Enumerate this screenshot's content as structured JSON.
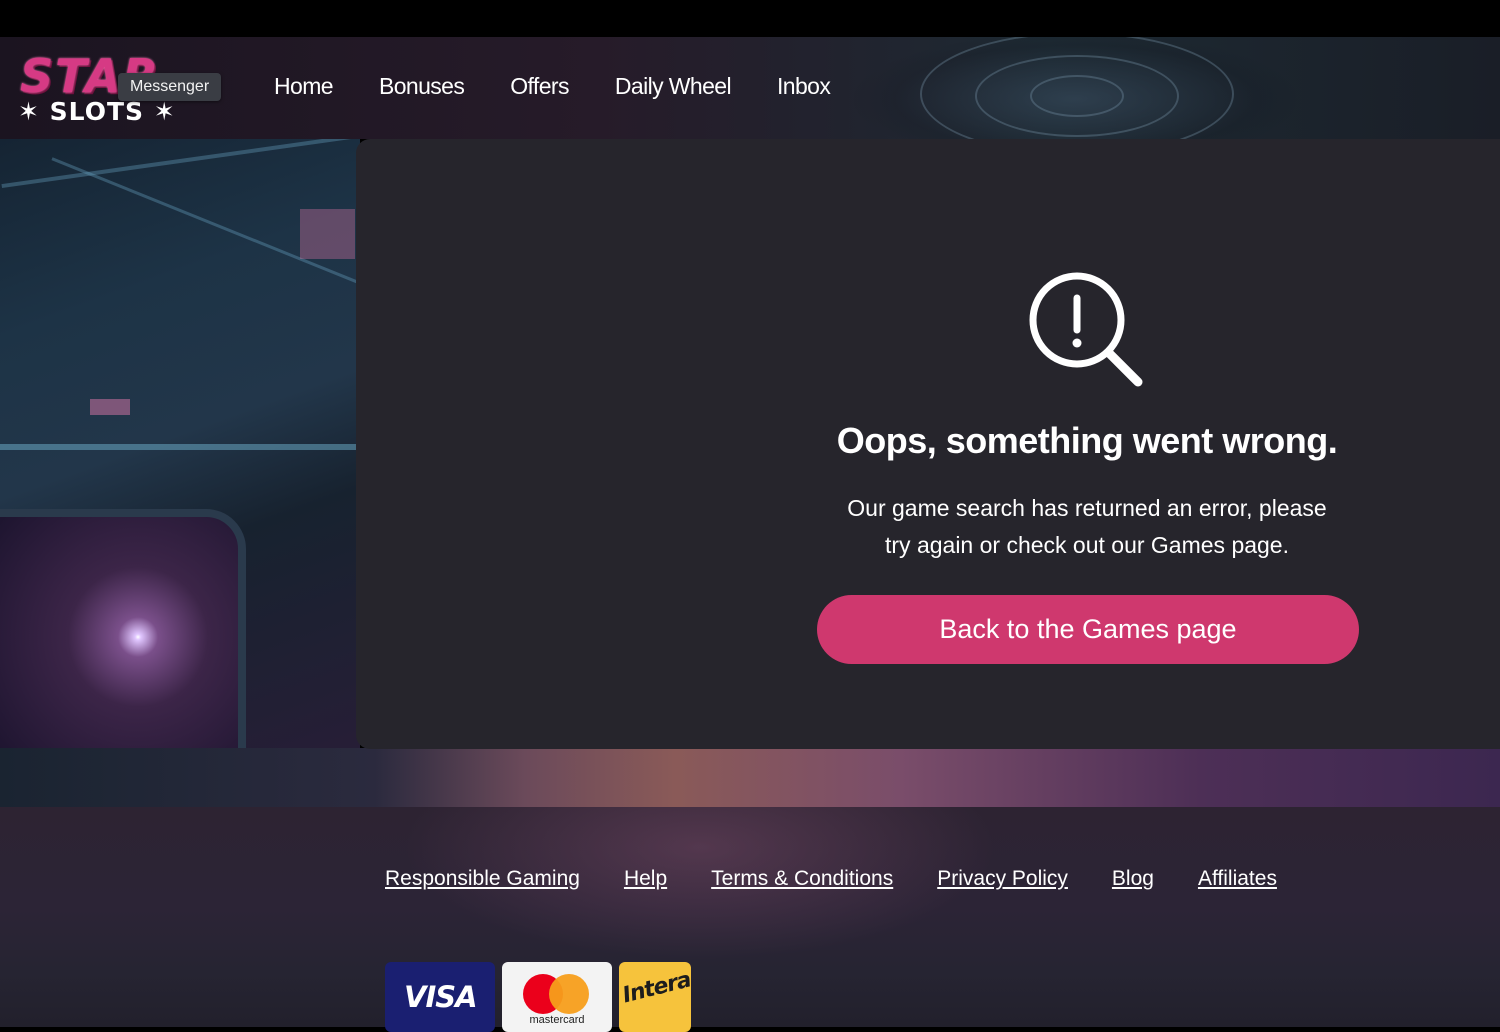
{
  "brand": {
    "logo_top": "STAR",
    "logo_bottom": "✶ SLOTS ✶",
    "tooltip": "Messenger"
  },
  "nav": {
    "items": [
      {
        "label": "Home"
      },
      {
        "label": "Bonuses"
      },
      {
        "label": "Offers"
      },
      {
        "label": "Daily Wheel"
      },
      {
        "label": "Inbox"
      }
    ]
  },
  "error": {
    "icon": "search-alert-icon",
    "title": "Oops, something went wrong.",
    "description": "Our game search has returned an error, please try again or check out our Games page.",
    "button_label": "Back to the Games page",
    "button_color": "#cf386e"
  },
  "footer": {
    "links": [
      {
        "label": "Responsible Gaming"
      },
      {
        "label": "Help"
      },
      {
        "label": "Terms & Conditions"
      },
      {
        "label": "Privacy Policy"
      },
      {
        "label": "Blog"
      },
      {
        "label": "Affiliates"
      }
    ],
    "payments": {
      "visa": "VISA",
      "mastercard": "mastercard",
      "interac": "Interac"
    }
  }
}
